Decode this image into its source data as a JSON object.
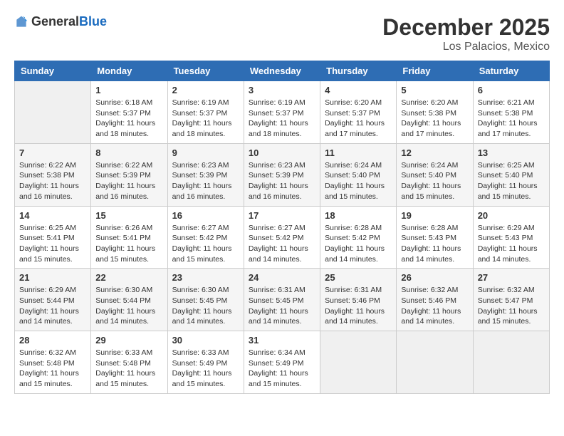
{
  "header": {
    "logo_general": "General",
    "logo_blue": "Blue",
    "month_title": "December 2025",
    "location": "Los Palacios, Mexico"
  },
  "calendar": {
    "days_of_week": [
      "Sunday",
      "Monday",
      "Tuesday",
      "Wednesday",
      "Thursday",
      "Friday",
      "Saturday"
    ],
    "weeks": [
      [
        {
          "day": "",
          "sunrise": "",
          "sunset": "",
          "daylight": ""
        },
        {
          "day": "1",
          "sunrise": "Sunrise: 6:18 AM",
          "sunset": "Sunset: 5:37 PM",
          "daylight": "Daylight: 11 hours and 18 minutes."
        },
        {
          "day": "2",
          "sunrise": "Sunrise: 6:19 AM",
          "sunset": "Sunset: 5:37 PM",
          "daylight": "Daylight: 11 hours and 18 minutes."
        },
        {
          "day": "3",
          "sunrise": "Sunrise: 6:19 AM",
          "sunset": "Sunset: 5:37 PM",
          "daylight": "Daylight: 11 hours and 18 minutes."
        },
        {
          "day": "4",
          "sunrise": "Sunrise: 6:20 AM",
          "sunset": "Sunset: 5:37 PM",
          "daylight": "Daylight: 11 hours and 17 minutes."
        },
        {
          "day": "5",
          "sunrise": "Sunrise: 6:20 AM",
          "sunset": "Sunset: 5:38 PM",
          "daylight": "Daylight: 11 hours and 17 minutes."
        },
        {
          "day": "6",
          "sunrise": "Sunrise: 6:21 AM",
          "sunset": "Sunset: 5:38 PM",
          "daylight": "Daylight: 11 hours and 17 minutes."
        }
      ],
      [
        {
          "day": "7",
          "sunrise": "Sunrise: 6:22 AM",
          "sunset": "Sunset: 5:38 PM",
          "daylight": "Daylight: 11 hours and 16 minutes."
        },
        {
          "day": "8",
          "sunrise": "Sunrise: 6:22 AM",
          "sunset": "Sunset: 5:39 PM",
          "daylight": "Daylight: 11 hours and 16 minutes."
        },
        {
          "day": "9",
          "sunrise": "Sunrise: 6:23 AM",
          "sunset": "Sunset: 5:39 PM",
          "daylight": "Daylight: 11 hours and 16 minutes."
        },
        {
          "day": "10",
          "sunrise": "Sunrise: 6:23 AM",
          "sunset": "Sunset: 5:39 PM",
          "daylight": "Daylight: 11 hours and 16 minutes."
        },
        {
          "day": "11",
          "sunrise": "Sunrise: 6:24 AM",
          "sunset": "Sunset: 5:40 PM",
          "daylight": "Daylight: 11 hours and 15 minutes."
        },
        {
          "day": "12",
          "sunrise": "Sunrise: 6:24 AM",
          "sunset": "Sunset: 5:40 PM",
          "daylight": "Daylight: 11 hours and 15 minutes."
        },
        {
          "day": "13",
          "sunrise": "Sunrise: 6:25 AM",
          "sunset": "Sunset: 5:40 PM",
          "daylight": "Daylight: 11 hours and 15 minutes."
        }
      ],
      [
        {
          "day": "14",
          "sunrise": "Sunrise: 6:25 AM",
          "sunset": "Sunset: 5:41 PM",
          "daylight": "Daylight: 11 hours and 15 minutes."
        },
        {
          "day": "15",
          "sunrise": "Sunrise: 6:26 AM",
          "sunset": "Sunset: 5:41 PM",
          "daylight": "Daylight: 11 hours and 15 minutes."
        },
        {
          "day": "16",
          "sunrise": "Sunrise: 6:27 AM",
          "sunset": "Sunset: 5:42 PM",
          "daylight": "Daylight: 11 hours and 15 minutes."
        },
        {
          "day": "17",
          "sunrise": "Sunrise: 6:27 AM",
          "sunset": "Sunset: 5:42 PM",
          "daylight": "Daylight: 11 hours and 14 minutes."
        },
        {
          "day": "18",
          "sunrise": "Sunrise: 6:28 AM",
          "sunset": "Sunset: 5:42 PM",
          "daylight": "Daylight: 11 hours and 14 minutes."
        },
        {
          "day": "19",
          "sunrise": "Sunrise: 6:28 AM",
          "sunset": "Sunset: 5:43 PM",
          "daylight": "Daylight: 11 hours and 14 minutes."
        },
        {
          "day": "20",
          "sunrise": "Sunrise: 6:29 AM",
          "sunset": "Sunset: 5:43 PM",
          "daylight": "Daylight: 11 hours and 14 minutes."
        }
      ],
      [
        {
          "day": "21",
          "sunrise": "Sunrise: 6:29 AM",
          "sunset": "Sunset: 5:44 PM",
          "daylight": "Daylight: 11 hours and 14 minutes."
        },
        {
          "day": "22",
          "sunrise": "Sunrise: 6:30 AM",
          "sunset": "Sunset: 5:44 PM",
          "daylight": "Daylight: 11 hours and 14 minutes."
        },
        {
          "day": "23",
          "sunrise": "Sunrise: 6:30 AM",
          "sunset": "Sunset: 5:45 PM",
          "daylight": "Daylight: 11 hours and 14 minutes."
        },
        {
          "day": "24",
          "sunrise": "Sunrise: 6:31 AM",
          "sunset": "Sunset: 5:45 PM",
          "daylight": "Daylight: 11 hours and 14 minutes."
        },
        {
          "day": "25",
          "sunrise": "Sunrise: 6:31 AM",
          "sunset": "Sunset: 5:46 PM",
          "daylight": "Daylight: 11 hours and 14 minutes."
        },
        {
          "day": "26",
          "sunrise": "Sunrise: 6:32 AM",
          "sunset": "Sunset: 5:46 PM",
          "daylight": "Daylight: 11 hours and 14 minutes."
        },
        {
          "day": "27",
          "sunrise": "Sunrise: 6:32 AM",
          "sunset": "Sunset: 5:47 PM",
          "daylight": "Daylight: 11 hours and 15 minutes."
        }
      ],
      [
        {
          "day": "28",
          "sunrise": "Sunrise: 6:32 AM",
          "sunset": "Sunset: 5:48 PM",
          "daylight": "Daylight: 11 hours and 15 minutes."
        },
        {
          "day": "29",
          "sunrise": "Sunrise: 6:33 AM",
          "sunset": "Sunset: 5:48 PM",
          "daylight": "Daylight: 11 hours and 15 minutes."
        },
        {
          "day": "30",
          "sunrise": "Sunrise: 6:33 AM",
          "sunset": "Sunset: 5:49 PM",
          "daylight": "Daylight: 11 hours and 15 minutes."
        },
        {
          "day": "31",
          "sunrise": "Sunrise: 6:34 AM",
          "sunset": "Sunset: 5:49 PM",
          "daylight": "Daylight: 11 hours and 15 minutes."
        },
        {
          "day": "",
          "sunrise": "",
          "sunset": "",
          "daylight": ""
        },
        {
          "day": "",
          "sunrise": "",
          "sunset": "",
          "daylight": ""
        },
        {
          "day": "",
          "sunrise": "",
          "sunset": "",
          "daylight": ""
        }
      ]
    ]
  }
}
